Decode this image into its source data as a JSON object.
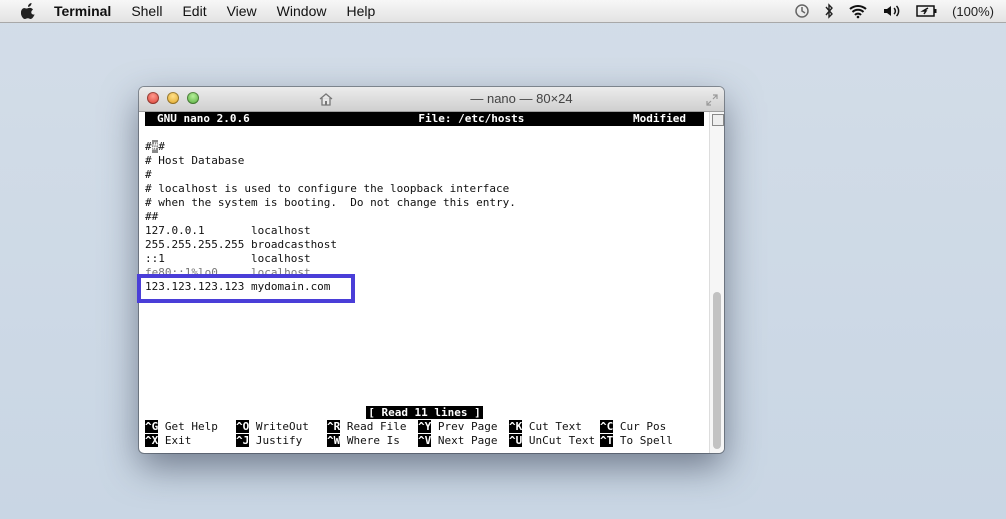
{
  "menubar": {
    "app_name": "Terminal",
    "items": [
      "Shell",
      "Edit",
      "View",
      "Window",
      "Help"
    ],
    "battery": "(100%)"
  },
  "window": {
    "title": "— nano — 80×24"
  },
  "nano": {
    "header_left": "GNU nano 2.0.6",
    "header_center": "File: /etc/hosts",
    "header_right": "Modified",
    "lines": [
      "",
      "###",
      "# Host Database",
      "#",
      "# localhost is used to configure the loopback interface",
      "# when the system is booting.  Do not change this entry.",
      "##",
      "127.0.0.1       localhost",
      "255.255.255.255 broadcasthost",
      "::1             localhost",
      "fe80::1%lo0     localhost",
      "123.123.123.123 mydomain.com"
    ],
    "status_message": "[ Read 11 lines ]",
    "shortcuts_row1": [
      {
        "key": "^G",
        "label": "Get Help"
      },
      {
        "key": "^O",
        "label": "WriteOut"
      },
      {
        "key": "^R",
        "label": "Read File"
      },
      {
        "key": "^Y",
        "label": "Prev Page"
      },
      {
        "key": "^K",
        "label": "Cut Text"
      },
      {
        "key": "^C",
        "label": "Cur Pos"
      }
    ],
    "shortcuts_row2": [
      {
        "key": "^X",
        "label": "Exit"
      },
      {
        "key": "^J",
        "label": "Justify"
      },
      {
        "key": "^W",
        "label": "Where Is"
      },
      {
        "key": "^V",
        "label": "Next Page"
      },
      {
        "key": "^U",
        "label": "UnCut Text"
      },
      {
        "key": "^T",
        "label": "To Spell"
      }
    ]
  },
  "colors": {
    "highlight_box": "#4a3ed8"
  }
}
